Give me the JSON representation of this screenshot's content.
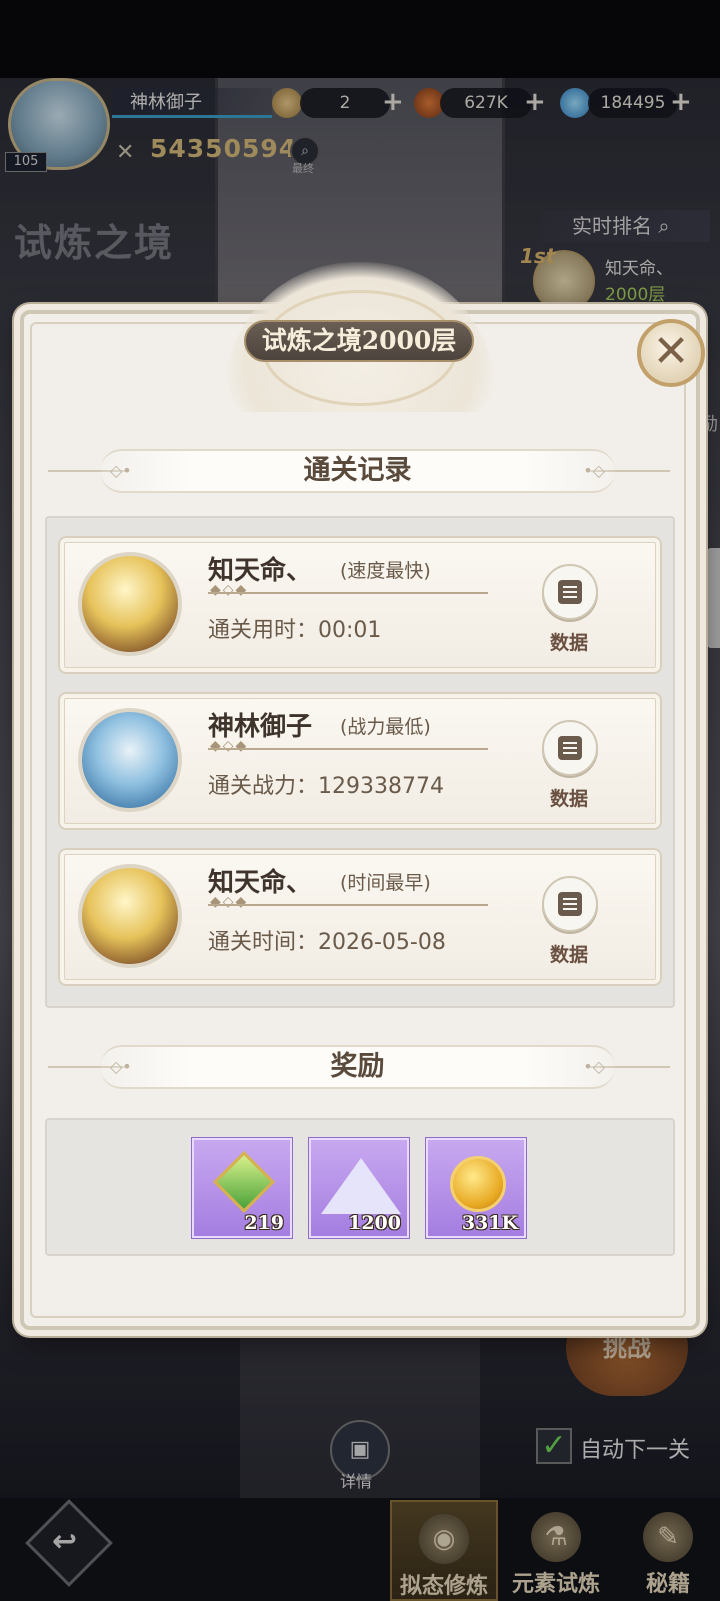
{
  "top_bar": {
    "level": "105",
    "player_name": "神林御子",
    "resource_1": "2",
    "resource_2": "627K",
    "resource_3": "184495",
    "plus": "+",
    "power": "54350594",
    "search_caption": "最终"
  },
  "mode": {
    "title": "试炼之境",
    "ranking_label": "实时排名",
    "rank_badge": "1st",
    "top_player_name": "知天命、",
    "top_player_floor": "2000层",
    "right_edge_text": "励"
  },
  "dialog": {
    "title": "试炼之境2000层",
    "close_icon": "close-icon",
    "records_header": "通关记录",
    "rewards_header": "奖励",
    "records": [
      {
        "name": "知天命、",
        "tag": "(速度最快)",
        "stat": "通关用时：00:01",
        "button": "数据",
        "avatar": "gold"
      },
      {
        "name": "神林御子",
        "tag": "(战力最低)",
        "stat": "通关战力：129338774",
        "button": "数据",
        "avatar": "blue"
      },
      {
        "name": "知天命、",
        "tag": "(时间最早)",
        "stat": "通关时间：2026-05-08",
        "button": "数据",
        "avatar": "gold"
      }
    ],
    "rewards": [
      {
        "icon": "green-gem-icon",
        "count": "219"
      },
      {
        "icon": "crystal-icon",
        "count": "1200"
      },
      {
        "icon": "gold-coin-icon",
        "count": "331K"
      }
    ]
  },
  "bottom": {
    "challenge": "挑战",
    "auto_next": "自动下一关",
    "details": "详情",
    "nav": [
      "拟态修炼",
      "元素试炼",
      "秘籍"
    ]
  },
  "colors": {
    "accent_gold": "#c2a06a",
    "panel_bg": "#f2efea",
    "reward_purple": "#a47ee0",
    "power_gold": "#d3b879",
    "floor_green": "#a7cf5e"
  }
}
